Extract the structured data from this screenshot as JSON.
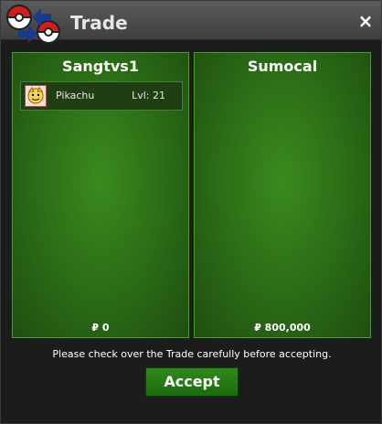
{
  "window": {
    "title": "Trade",
    "close_label": "×"
  },
  "left": {
    "name": "Sangtvs1",
    "money": "₽ 0",
    "items": [
      {
        "name": "Pikachu",
        "level": "Lvl: 21",
        "icon": "pikachu-icon"
      }
    ]
  },
  "right": {
    "name": "Sumocal",
    "money": "₽ 800,000",
    "items": []
  },
  "footer": {
    "notice": "Please check over the Trade carefully before accepting.",
    "accept_label": "Accept"
  },
  "colors": {
    "accent": "#2e8a1a",
    "panel": "#2a6a16",
    "titlebar": "#4b4b4b"
  }
}
